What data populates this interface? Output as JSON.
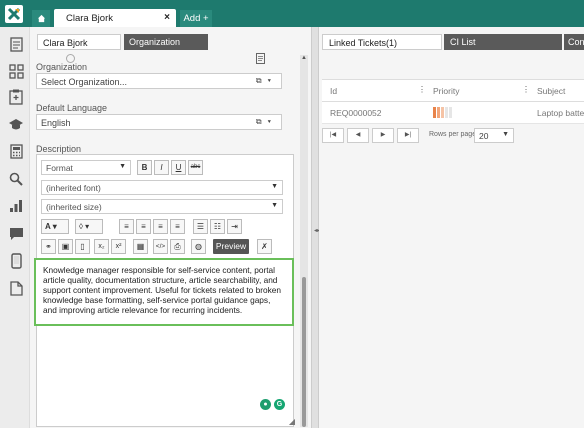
{
  "app": {
    "logo_icon": "x-logo-icon",
    "brand_color": "#1e7a6e",
    "tabs": [
      {
        "label": "Clara Bjork",
        "close_glyph": "×"
      }
    ],
    "add_tab_label": "Add +"
  },
  "left_nav": {
    "icons": [
      "document-icon",
      "grid-icon",
      "clipboard-icon",
      "graduation-cap-icon",
      "calculator-icon",
      "search-icon",
      "bar-chart-icon",
      "chat-icon",
      "mobile-icon",
      "file-icon"
    ]
  },
  "form": {
    "subtabs": [
      "Clara Bjork",
      "Organization"
    ],
    "organization": {
      "label": "Organization",
      "value": "Select Organization..."
    },
    "language": {
      "label": "Default Language",
      "value": "English"
    },
    "description": {
      "label": "Description",
      "toolbar": {
        "format": "Format",
        "font": "(inherited font)",
        "size": "(inherited size)",
        "bold": "B",
        "italic": "I",
        "underline": "U",
        "strike": "abc",
        "preview": "Preview"
      },
      "content": "Knowledge manager responsible for self-service content, portal article quality, documentation structure, article searchability, and support content improvement. Useful for tickets related to broken knowledge base formatting, self-service portal guidance gaps, and improving article relevance for recurring incidents."
    }
  },
  "right": {
    "tabs": [
      "Linked Tickets(1)",
      "CI List",
      "Cont"
    ],
    "columns": [
      "Id",
      "Priority",
      "Subject"
    ],
    "rows": [
      {
        "id": "REQ0000052",
        "subject": "Laptop batter"
      }
    ],
    "pager": {
      "rows_per_page_label": "Rows per page:",
      "rows_per_page": "20"
    }
  }
}
